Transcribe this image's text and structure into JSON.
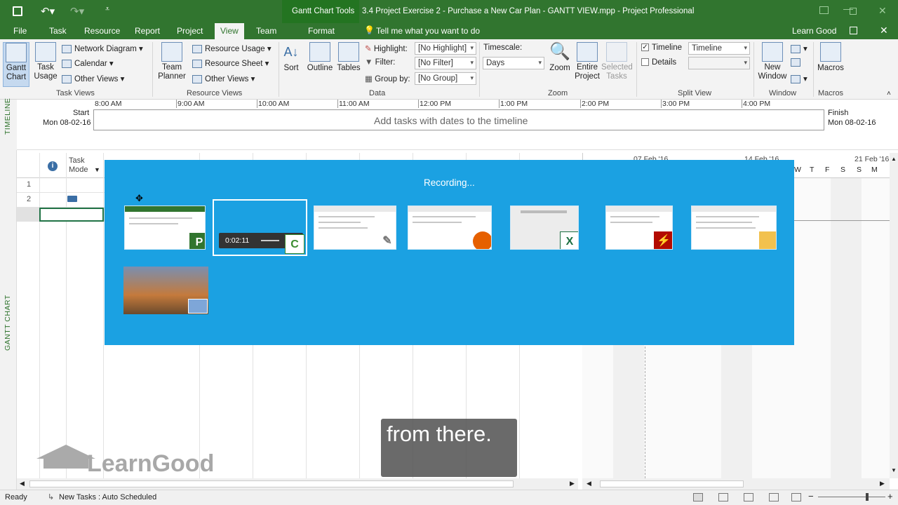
{
  "title_bar": {
    "context_tab": "Gantt Chart Tools",
    "title": "3.4 Project Exercise 2 - Purchase a New Car Plan - GANTT VIEW.mpp - Project Professional"
  },
  "tabs": [
    "File",
    "Task",
    "Resource",
    "Report",
    "Project",
    "View",
    "Team",
    "Format"
  ],
  "active_tab": "View",
  "tell_me": "Tell me what you want to do",
  "user": "Learn Good",
  "ribbon": {
    "task_views": {
      "label": "Task Views",
      "gantt": "Gantt Chart",
      "task_usage": "Task Usage",
      "network": "Network Diagram",
      "calendar": "Calendar",
      "other": "Other Views"
    },
    "resource_views": {
      "label": "Resource Views",
      "team_planner": "Team Planner",
      "usage": "Resource Usage",
      "sheet": "Resource Sheet",
      "other": "Other Views"
    },
    "data": {
      "label": "Data",
      "sort": "Sort",
      "outline": "Outline",
      "tables": "Tables",
      "highlight": "Highlight:",
      "highlight_val": "[No Highlight]",
      "filter": "Filter:",
      "filter_val": "[No Filter]",
      "group": "Group by:",
      "group_val": "[No Group]"
    },
    "zoom": {
      "label": "Zoom",
      "timescale": "Timescale:",
      "timescale_val": "Days",
      "zoom": "Zoom",
      "entire": "Entire Project",
      "selected": "Selected Tasks"
    },
    "split": {
      "label": "Split View",
      "timeline": "Timeline",
      "timeline_val": "Timeline",
      "details": "Details"
    },
    "window": {
      "label": "Window",
      "new_window": "New Window"
    },
    "macros": {
      "label": "Macros",
      "macros": "Macros"
    }
  },
  "timeline": {
    "side_label": "TIMELINE",
    "start_label": "Start",
    "start_date": "Mon 08-02-16",
    "finish_label": "Finish",
    "finish_date": "Mon 08-02-16",
    "placeholder": "Add tasks with dates to the timeline",
    "ticks": [
      "8:00 AM",
      "9:00 AM",
      "10:00 AM",
      "11:00 AM",
      "12:00 PM",
      "1:00 PM",
      "2:00 PM",
      "3:00 PM",
      "4:00 PM"
    ]
  },
  "gantt": {
    "side_label": "GANTT CHART",
    "col_mode": "Task Mode",
    "rows": [
      "1",
      "2"
    ],
    "date_a": "07 Feb '16",
    "date_b": "14 Feb '16",
    "date_c": "21 Feb '16",
    "days": [
      "W",
      "T",
      "F",
      "S",
      "S",
      "M"
    ]
  },
  "switcher": {
    "status": "Recording...",
    "timer": "0:02:11"
  },
  "caption": "from there.",
  "logo": "LearnGood",
  "status_bar": {
    "ready": "Ready",
    "new_tasks": "New Tasks : Auto Scheduled"
  },
  "colors": {
    "brand": "#31752f",
    "overlay": "#1ba1e2"
  }
}
